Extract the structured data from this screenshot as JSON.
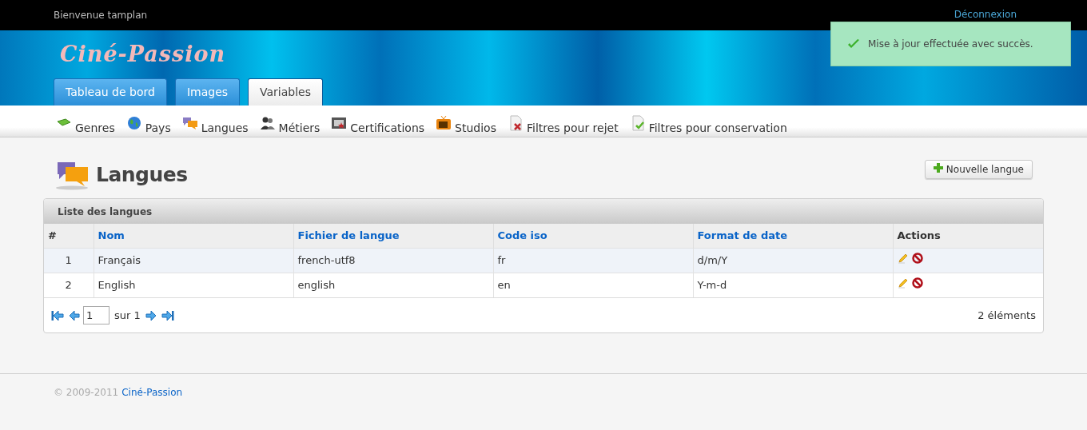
{
  "top_bar": {
    "welcome": "Bienvenue tamplan",
    "logout": "Déconnexion"
  },
  "toast": {
    "message": "Mise à jour effectuée avec succès."
  },
  "logo": "Ciné-Passion",
  "tabs": [
    {
      "label": "Tableau de bord",
      "selected": false
    },
    {
      "label": "Images",
      "selected": false
    },
    {
      "label": "Variables",
      "selected": true
    }
  ],
  "submenu": [
    "Genres",
    "Pays",
    "Langues",
    "Métiers",
    "Certifications",
    "Studios",
    "Filtres pour rejet",
    "Filtres pour conservation"
  ],
  "page_title": "Langues",
  "new_button": "Nouvelle langue",
  "panel": {
    "title": "Liste des langues",
    "columns": [
      {
        "label": "#",
        "sortable": false
      },
      {
        "label": "Nom",
        "sortable": true
      },
      {
        "label": "Fichier de langue",
        "sortable": true
      },
      {
        "label": "Code iso",
        "sortable": true
      },
      {
        "label": "Format de date",
        "sortable": true
      },
      {
        "label": "Actions",
        "sortable": false
      }
    ],
    "rows": [
      [
        "1",
        "Français",
        "french-utf8",
        "fr",
        "d/m/Y"
      ],
      [
        "2",
        "English",
        "english",
        "en",
        "Y-m-d"
      ]
    ],
    "pager": {
      "page": "1",
      "of": "sur 1",
      "count": "2 éléments"
    }
  },
  "footer": {
    "copyright": "© 2009-2011",
    "link": "Ciné-Passion"
  }
}
